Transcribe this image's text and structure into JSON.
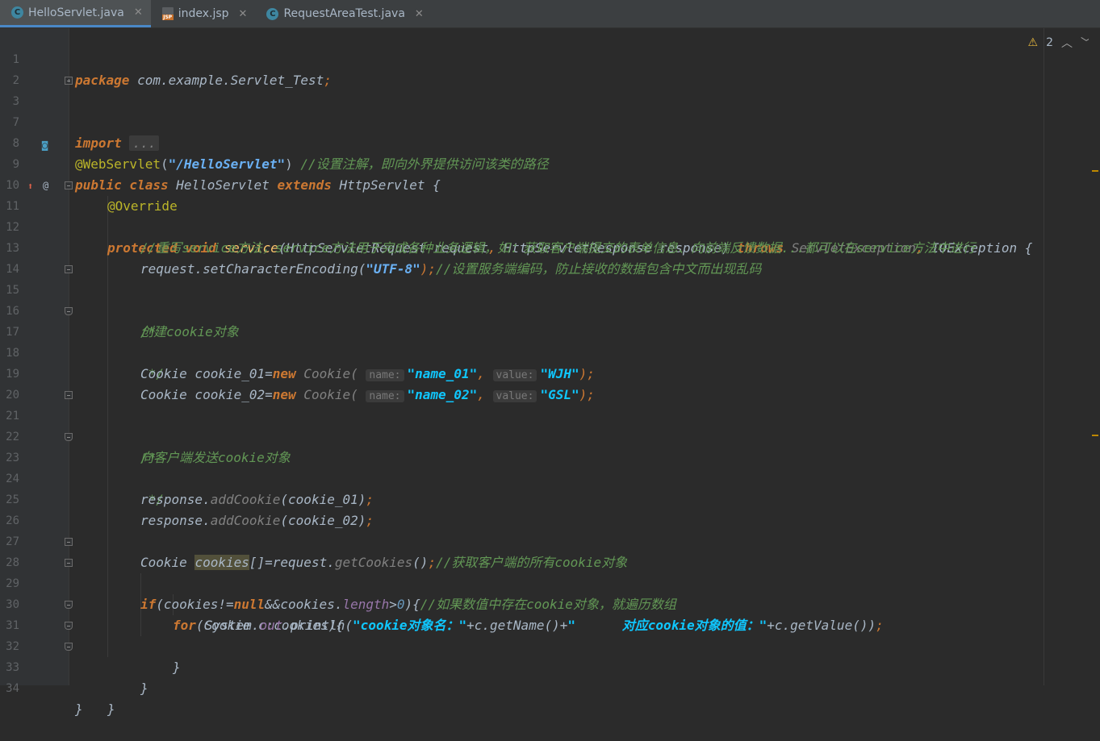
{
  "tabs": [
    {
      "label": "HelloServlet.java",
      "type": "java",
      "active": true
    },
    {
      "label": "index.jsp",
      "type": "jsp",
      "active": false
    },
    {
      "label": "RequestAreaTest.java",
      "type": "java",
      "active": false
    }
  ],
  "inspection": {
    "warnings": "2",
    "icon": "warning-icon"
  },
  "lines": {
    "l1": {
      "num": "1",
      "package_kw": "package",
      "pkg": " com.example.Servlet_Test",
      "semi": ";"
    },
    "l2": {
      "num": "2"
    },
    "l3": {
      "num": "3",
      "import_kw": "import",
      "folded": "..."
    },
    "l7": {
      "num": "7"
    },
    "l8": {
      "num": "8",
      "annotation": "@WebServlet",
      "open": "(",
      "path": "\"/HelloServlet\"",
      "close": ")",
      "comment": " //设置注解，即向外界提供访问该类的路径"
    },
    "l9": {
      "num": "9",
      "public_kw": "public class",
      "cls": " HelloServlet ",
      "extends_kw": "extends",
      "parent": " HttpServlet {"
    },
    "l10": {
      "num": "10",
      "annotation": "@Override"
    },
    "l11": {
      "num": "11",
      "prot_kw": "protected void",
      "method": "service",
      "params1": "(HttpServletRequest request",
      "comma1": ",",
      "params2": " HttpServletResponse response) ",
      "throws_kw": "throws",
      "ex1": " ServletException",
      "comma2": ",",
      "ex2": " IOException {"
    },
    "l12": {
      "num": "12",
      "comment": "//重写service方法，service方法用于完成各种业务逻辑，如：获取客户端提交的表单信息、向前端反馈数据...都可以在service方法中进行"
    },
    "l13": {
      "num": "13",
      "obj": "request.",
      "method": "setCharacterEncoding",
      "open": "(",
      "arg": "\"UTF-8\"",
      "close": ");",
      "comment": "//设置服务端编码，防止接收的数据包含中文而出现乱码"
    },
    "l14": {
      "num": "14"
    },
    "l15": {
      "num": "15",
      "comment": "/*"
    },
    "l16": {
      "num": "16",
      "comment": "创建cookie对象"
    },
    "l17": {
      "num": "17",
      "comment": " */"
    },
    "l18": {
      "num": "18",
      "type": "Cookie cookie_01=",
      "new_kw": "new",
      "ctor": " Cookie(",
      "hint1": "name:",
      "arg1": "\"name_01\"",
      "comma": ",",
      "hint2": "value:",
      "arg2": "\"WJH\"",
      "close": ");"
    },
    "l19": {
      "num": "19",
      "type": "Cookie cookie_02=",
      "new_kw": "new",
      "ctor": " Cookie(",
      "hint1": "name:",
      "arg1": "\"name_02\"",
      "comma": ",",
      "hint2": "value:",
      "arg2": "\"GSL\"",
      "close": ");"
    },
    "l20": {
      "num": "20"
    },
    "l21": {
      "num": "21",
      "comment": "/*"
    },
    "l22": {
      "num": "22",
      "comment": "向客户端发送cookie对象"
    },
    "l23": {
      "num": "23",
      "comment": " */"
    },
    "l24": {
      "num": "24",
      "obj": "response.",
      "method": "addCookie",
      "args": "(cookie_01)",
      "semi": ";"
    },
    "l25": {
      "num": "25",
      "obj": "response.",
      "method": "addCookie",
      "args": "(cookie_02)",
      "semi": ";"
    },
    "l26": {
      "num": "26"
    },
    "l27": {
      "num": "27",
      "type": "Cookie ",
      "var": "cookies",
      "rest": "[]=request.",
      "method": "getCookies",
      "call": "()",
      "semi": ";",
      "comment": "//获取客户端的所有cookie对象"
    },
    "l28": {
      "num": "28",
      "if_kw": "if",
      "cond1": "(cookies!=",
      "null_kw": "null",
      "cond2": "&&cookies.",
      "field": "length",
      "cond3": ">",
      "zero": "0",
      "cond4": "){",
      "comment": "//如果数值中存在cookie对象，就遍历数组"
    },
    "l29": {
      "num": "29",
      "for_kw": "for",
      "rest": "(Cookie c:cookies){"
    },
    "l30": {
      "num": "30",
      "sys": "System.",
      "out": "out",
      "dot": ".",
      "println": "println(",
      "s1": "\"cookie对象名：\"",
      "mid": "+c.getName()+",
      "s2": "\"      对应cookie对象的值：\"",
      "end": "+c.getValue())",
      "semi": ";"
    },
    "l31": {
      "num": "31",
      "text": "}"
    },
    "l32": {
      "num": "32",
      "text": "}"
    },
    "l33": {
      "num": "33",
      "text": "}"
    },
    "l34": {
      "num": "34",
      "text": "}"
    }
  }
}
